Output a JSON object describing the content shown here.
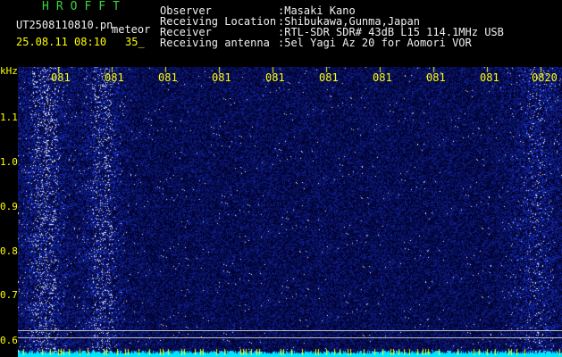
{
  "header": {
    "app_title": "HROFFT",
    "file_name": "UT2508110810.pn",
    "meteor_label": "meteor",
    "date_time": "25.08.11 08:10",
    "level_value": "35_",
    "info": [
      {
        "label": "Observer",
        "value": ":Masaki Kano"
      },
      {
        "label": "Receiving Location",
        "value": ":Shibukawa,Gunma,Japan"
      },
      {
        "label": "Receiver",
        "value": ":RTL-SDR SDR# 43dB L15 114.1MHz USB"
      },
      {
        "label": "Receiving antenna",
        "value": ":5el Yagi Az 20 for Aomori VOR"
      }
    ]
  },
  "spectrogram": {
    "freq_unit": "kHz",
    "freq_ticks": [
      "1.1",
      "1.0",
      "0.9",
      "0.8",
      "0.7",
      "0.6"
    ],
    "time_ticks": [
      "081",
      "081",
      "081",
      "081",
      "081",
      "081",
      "081",
      "081",
      "081",
      "0820"
    ],
    "colors": {
      "background": "#000010",
      "signal": "#1e3cff",
      "bright": "#c8e6ff",
      "baseline": "#00e5ff",
      "tick_marker": "#ffff00"
    }
  }
}
